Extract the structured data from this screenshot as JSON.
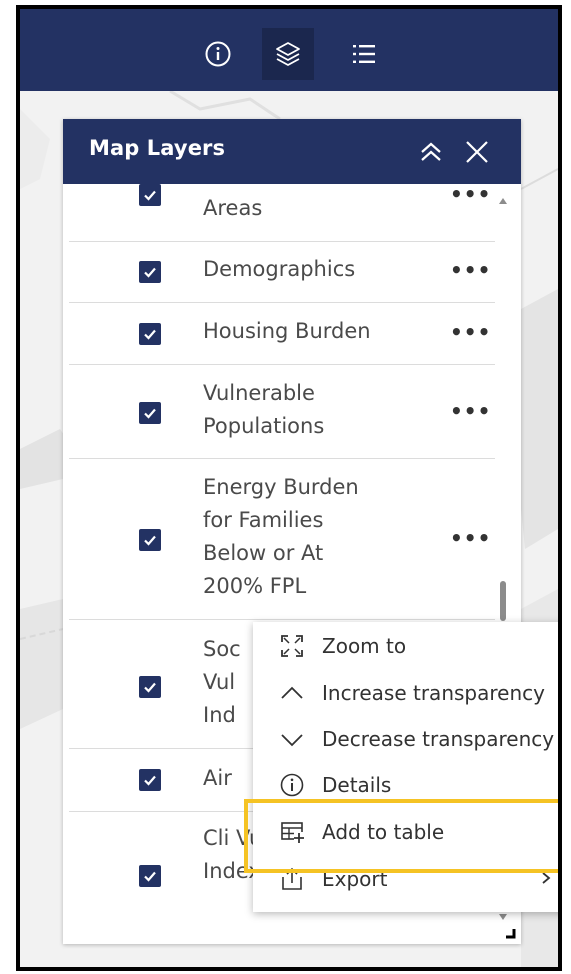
{
  "header": {
    "tabs": [
      {
        "icon": "info-icon",
        "active": false
      },
      {
        "icon": "layers-icon",
        "active": true
      },
      {
        "icon": "legend-list-icon",
        "active": false
      }
    ],
    "bar_color": "#233263"
  },
  "panel": {
    "title": "Map Layers",
    "collapse_icon": "double-chevron-up-icon",
    "close_icon": "close-icon"
  },
  "layers": [
    {
      "label": "Areas",
      "checked": true
    },
    {
      "label": "Demographics",
      "checked": true
    },
    {
      "label": "Housing Burden",
      "checked": true
    },
    {
      "label": "Vulnerable Populations",
      "checked": true
    },
    {
      "label": "Energy Burden for Families Below or At 200% FPL",
      "checked": true
    },
    {
      "label": "Soc Vul Ind",
      "checked": true
    },
    {
      "label": "Air",
      "checked": true
    },
    {
      "label": "Cli Vu Index",
      "checked": true
    }
  ],
  "more_label": "•••",
  "context_menu": {
    "items": [
      {
        "label": "Zoom to",
        "icon": "zoom-to-extent-icon"
      },
      {
        "label": "Increase transparency",
        "icon": "chevron-up-icon"
      },
      {
        "label": "Decrease transparency",
        "icon": "chevron-down-icon"
      },
      {
        "label": "Details",
        "icon": "info-icon"
      },
      {
        "label": "Add to table",
        "icon": "add-table-icon",
        "highlighted": true
      },
      {
        "label": "Export",
        "icon": "export-icon",
        "submenu": true
      }
    ]
  },
  "colors": {
    "accent": "#233263",
    "highlight": "#f5c324"
  }
}
